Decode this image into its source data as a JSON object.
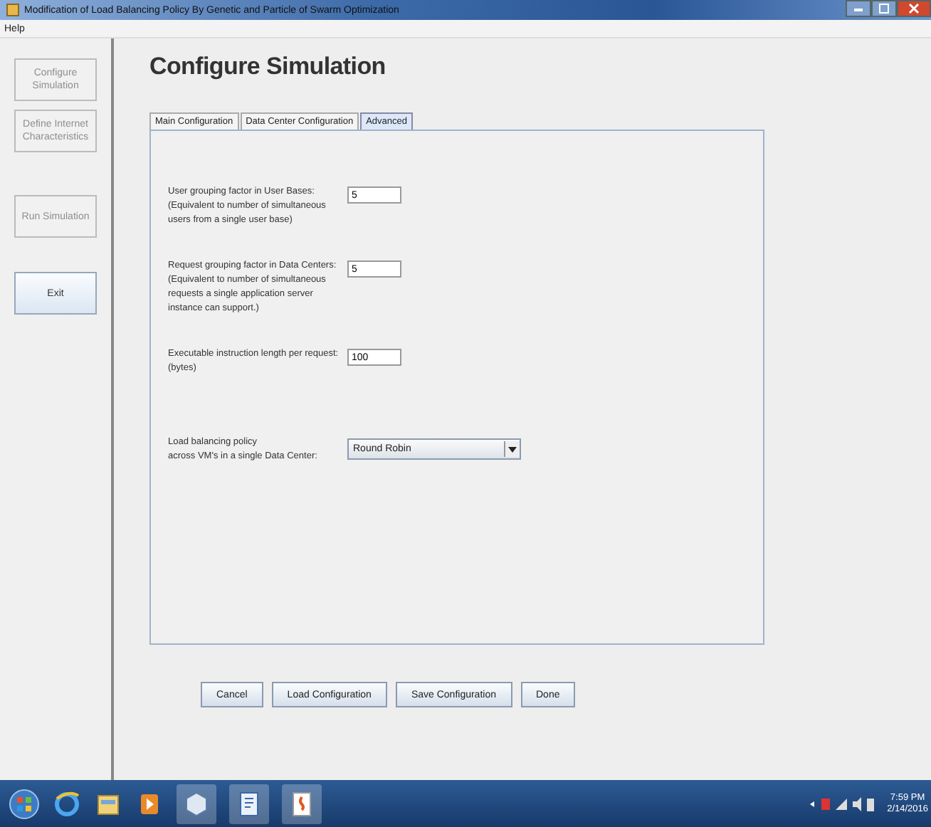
{
  "window": {
    "title": "Modification of Load Balancing Policy By Genetic and Particle of Swarm Optimization"
  },
  "menu": [
    "Help"
  ],
  "sidebar": {
    "buttons": [
      {
        "label": "Configure Simulation",
        "disabled": true
      },
      {
        "label": "Define Internet Characteristics",
        "disabled": true
      },
      {
        "label": "Run Simulation",
        "disabled": true
      },
      {
        "label": "Exit",
        "disabled": false
      }
    ]
  },
  "heading": "Configure Simulation",
  "tabs": [
    {
      "label": "Main Configuration",
      "selected": false
    },
    {
      "label": "Data Center Configuration",
      "selected": false
    },
    {
      "label": "Advanced",
      "selected": true
    }
  ],
  "fields": [
    {
      "kind": "text",
      "label": [
        "User grouping factor in User Bases:",
        "(Equivalent to number of simultaneous",
        "users from a single user base)"
      ],
      "value": "5"
    },
    {
      "kind": "text",
      "label": [
        "Request grouping factor in Data Centers:",
        "(Equivalent to number of simultaneous",
        "requests a single application server",
        "instance can support.)"
      ],
      "value": "5"
    },
    {
      "kind": "text",
      "label": [
        "Executable instruction length per request:",
        "(bytes)"
      ],
      "value": "100"
    },
    {
      "kind": "dropdown",
      "label": [
        "Load balancing policy",
        "across VM's in a single Data Center:"
      ],
      "value": "Round Robin"
    }
  ],
  "buttons": [
    "Cancel",
    "Load Configuration",
    "Save Configuration",
    "Done"
  ],
  "taskbar": {
    "time": "7:59 PM",
    "date": "2/14/2016"
  }
}
